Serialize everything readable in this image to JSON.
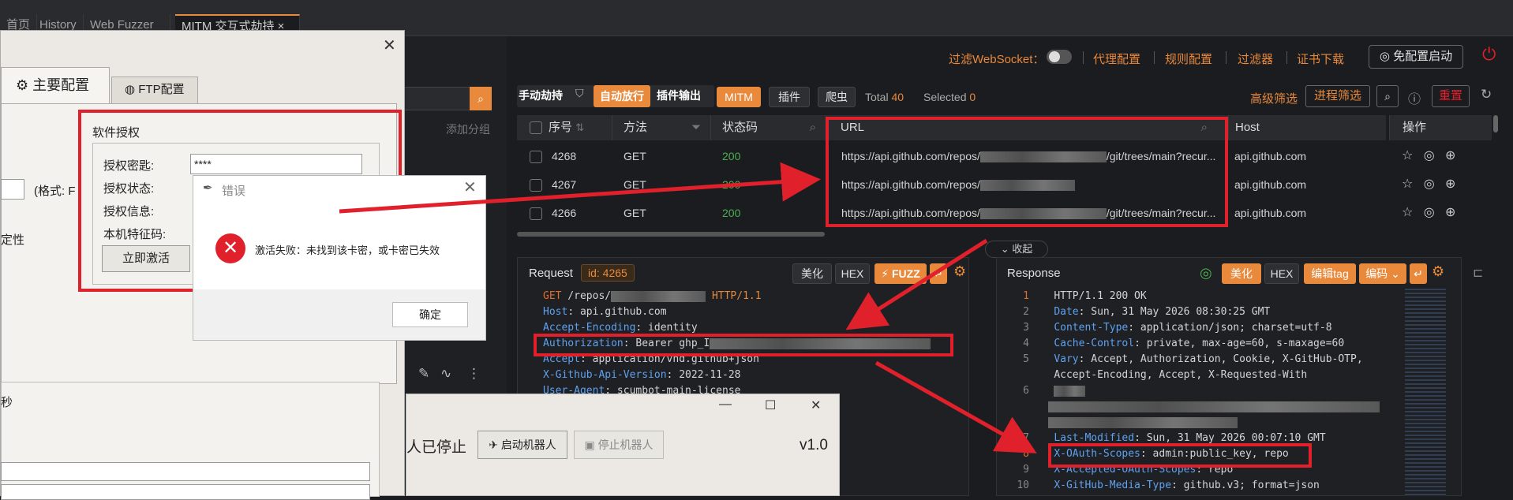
{
  "tabs": [
    "首页",
    "History",
    "Web Fuzzer",
    "MITM 交互式劫持"
  ],
  "toolbar": {
    "filter_ws": "过滤WebSocket：",
    "proxy_config": "代理配置",
    "rule_config": "规则配置",
    "filter": "过滤器",
    "cert_download": "证书下载",
    "free_start": "免配置启动"
  },
  "left": {
    "add_group": "添加分组"
  },
  "mitm": {
    "manual": "手动劫持",
    "auto": "自动放行",
    "plugin_out": "插件输出",
    "mitm": "MITM",
    "plugin": "插件",
    "crawler": "爬虫",
    "total_label": "Total",
    "total": "40",
    "selected_label": "Selected",
    "selected": "0",
    "adv_filter": "高级筛选",
    "proc_filter": "进程筛选",
    "reset": "重置",
    "collapse": "收起"
  },
  "table": {
    "headers": [
      "序号",
      "方法",
      "状态码",
      "URL",
      "Host",
      "操作"
    ],
    "rows": [
      {
        "id": "4268",
        "method": "GET",
        "status": "200",
        "url_a": "https://api.github.com/repos/",
        "url_b": "/git/trees/main?recur...",
        "host": "api.github.com"
      },
      {
        "id": "4267",
        "method": "GET",
        "status": "200",
        "url_a": "https://api.github.com/repos/",
        "url_b": "",
        "host": "api.github.com"
      },
      {
        "id": "4266",
        "method": "GET",
        "status": "200",
        "url_a": "https://api.github.com/repos/",
        "url_b": "/git/trees/main?recur...",
        "host": "api.github.com"
      }
    ]
  },
  "request": {
    "title": "Request",
    "id_label": "id: 4265",
    "beautify": "美化",
    "hex": "HEX",
    "fuzz": "FUZZ",
    "lines": [
      {
        "k": "GET",
        "v": " /repos/"
      },
      {
        "k": "Host",
        "v": ": api.github.com"
      },
      {
        "k": "Accept-Encoding",
        "v": ": identity"
      },
      {
        "k": "Authorization",
        "v": ": Bearer ghp_I"
      },
      {
        "k": "Accept",
        "v": ": application/vnd.github+json"
      },
      {
        "k": "X-Github-Api-Version",
        "v": ": 2022-11-28"
      },
      {
        "k": "User-Agent",
        "v": ": scumbot-main-license"
      }
    ],
    "http_ver": "HTTP/1.1"
  },
  "response": {
    "title": "Response",
    "beautify": "美化",
    "hex": "HEX",
    "edit_tag": "编辑tag",
    "encode": "编码",
    "lines": [
      {
        "n": "1",
        "k": "",
        "v": "HTTP/1.1 200 OK"
      },
      {
        "n": "2",
        "k": "Date",
        "v": ": Sun, 31 May 2026 08:30:25 GMT"
      },
      {
        "n": "3",
        "k": "Content-Type",
        "v": ": application/json; charset=utf-8"
      },
      {
        "n": "4",
        "k": "Cache-Control",
        "v": ": private, max-age=60, s-maxage=60"
      },
      {
        "n": "5",
        "k": "Vary",
        "v": ": Accept, Authorization, Cookie, X-GitHub-OTP,"
      },
      {
        "n": "",
        "k": "",
        "v": "Accept-Encoding, Accept, X-Requested-With"
      },
      {
        "n": "6",
        "k": "",
        "v": ""
      },
      {
        "n": "7",
        "k": "Last-Modified",
        "v": ": Sun, 31 May 2026 00:07:10 GMT"
      },
      {
        "n": "8",
        "k": "X-OAuth-Scopes",
        "v": ": admin:public_key, repo"
      },
      {
        "n": "9",
        "k": "X-Accepted-OAuth-Scopes",
        "v": ": repo"
      },
      {
        "n": "10",
        "k": "X-GitHub-Media-Type",
        "v": ": github.v3; format=json"
      }
    ]
  },
  "config_dialog": {
    "tab_main": "主要配置",
    "tab_ftp": "FTP配置",
    "group_title": "软件授权",
    "key_label": "授权密匙:",
    "key_value": "****",
    "status_label": "授权状态:",
    "info_label": "授权信息:",
    "machine_label": "本机特征码:",
    "activate": "立即激活",
    "format_hint": "(格式: F",
    "stability": "定性",
    "seconds": "秒"
  },
  "error_dialog": {
    "title": "错误",
    "message": "激活失败：未找到该卡密，或卡密已失效",
    "ok": "确定"
  },
  "bot_window": {
    "stopped": "人已停止",
    "start": "启动机器人",
    "stop": "停止机器人",
    "version": "v1.0"
  },
  "colors": {
    "accent": "#e8893b",
    "red": "#e0202a",
    "green": "#4caf50"
  }
}
